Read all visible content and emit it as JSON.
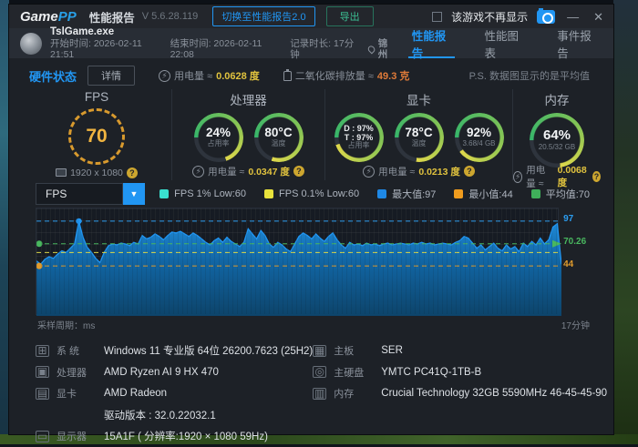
{
  "titlebar": {
    "logo_game": "Game",
    "logo_pp": "PP",
    "app_title": "性能报告",
    "version": "V 5.6.28.119",
    "switch_button": "切换至性能报告2.0",
    "export_button": "导出",
    "dont_show_label": "该游戏不再显示"
  },
  "gamebar": {
    "exe_name": "TslGame.exe",
    "start_time": "开始时间: 2026-02-11 21:51",
    "end_time": "结束时间: 2026-02-11 22:08",
    "duration": "记录时长: 17分钟",
    "location": "锦州",
    "tabs": [
      {
        "label": "性能报告",
        "active": true
      },
      {
        "label": "性能图表",
        "active": false
      },
      {
        "label": "事件报告",
        "active": false
      }
    ]
  },
  "statusbar": {
    "hardware_status": "硬件状态",
    "details_button": "详情",
    "power_label": "用电量 ≈",
    "power_value": "0.0628 度",
    "co2_label": "二氧化碳排放量 ≈",
    "co2_value": "49.3 克",
    "ps_note": "P.S. 数据图显示的是平均值"
  },
  "gauges": {
    "fps": {
      "title": "FPS",
      "value": "70",
      "resolution": "1920 x 1080"
    },
    "cpu": {
      "title": "处理器",
      "usage": "24%",
      "usage_label": "占用率",
      "temp": "80°C",
      "temp_label": "温度",
      "power_label": "用电量 ≈",
      "power_value": "0.0347 度"
    },
    "gpu": {
      "title": "显卡",
      "dt_line1": "D : 97%",
      "dt_line2": "T : 97%",
      "usage_label": "占用率",
      "temp": "78°C",
      "temp_label": "温度",
      "vram_pct": "92%",
      "vram_detail": "3.68/4 GB",
      "power_label": "用电量 ≈",
      "power_value": "0.0213 度"
    },
    "ram": {
      "title": "内存",
      "pct": "64%",
      "detail": "20.5/32 GB",
      "power_label": "用电量 ≈",
      "power_value": "0.0068 度"
    }
  },
  "chart_controls": {
    "selector_value": "FPS",
    "legend": [
      {
        "label": "FPS 1% Low:60",
        "color": "#39e0cf"
      },
      {
        "label": "FPS 0.1% Low:60",
        "color": "#e8e23c"
      },
      {
        "label": "最大值:97",
        "color": "#1e88e5"
      },
      {
        "label": "最小值:44",
        "color": "#f09c1e"
      },
      {
        "label": "平均值:70",
        "color": "#3faf5a"
      }
    ]
  },
  "chart_data": {
    "type": "area",
    "series_name": "FPS",
    "x_left_label": "采样周期：ms",
    "x_right_label": "17分钟",
    "ylim": [
      -15,
      112
    ],
    "stats": {
      "max": 97,
      "min": 44,
      "avg": 70.26,
      "fps_1pct_low": 60,
      "fps_01pct_low": 60
    },
    "ref_lines": [
      {
        "value": 97,
        "label": "97",
        "color": "#2b9df0",
        "name": "max"
      },
      {
        "value": 70.26,
        "label": "70.26",
        "color": "#49b75f",
        "name": "avg"
      },
      {
        "value": 60,
        "label": "",
        "color": "#ded94a",
        "name": "low"
      },
      {
        "value": 44,
        "label": "44",
        "color": "#e09b2d",
        "name": "min"
      }
    ],
    "line_color": "#2196f3",
    "values": [
      50,
      46,
      52,
      55,
      53,
      58,
      62,
      60,
      65,
      70,
      97,
      78,
      66,
      60,
      53,
      48,
      60,
      68,
      70,
      69,
      71,
      70,
      68,
      72,
      70,
      80,
      76,
      78,
      82,
      79,
      75,
      80,
      84,
      83,
      85,
      82,
      79,
      83,
      80,
      76,
      72,
      69,
      74,
      77,
      72,
      78,
      73,
      70,
      67,
      72,
      88,
      82,
      76,
      86,
      80,
      70,
      66,
      72,
      69,
      64,
      61,
      70,
      79,
      83,
      80,
      76,
      82,
      77,
      73,
      79,
      83,
      75,
      69,
      65,
      72,
      69,
      70,
      68,
      71,
      69,
      70,
      68,
      70,
      71,
      69,
      70,
      71,
      70,
      69,
      71,
      70,
      72,
      70,
      71,
      69,
      70,
      71,
      70,
      69,
      72,
      74,
      79,
      77,
      71,
      65,
      69,
      63,
      67,
      71,
      65,
      62,
      69,
      64,
      67,
      61,
      71,
      67,
      73,
      69,
      77,
      70,
      75,
      90,
      94,
      46
    ]
  },
  "sysinfo": {
    "rows_left": [
      {
        "label": "系 统",
        "value": "Windows 11 专业版 64位 26200.7623 (25H2)"
      },
      {
        "label": "处理器",
        "value": "AMD Ryzen AI 9 HX 470"
      },
      {
        "label": "显卡",
        "value": "AMD Radeon"
      },
      {
        "label": "",
        "value": "驱动版本 : 32.0.22032.1"
      },
      {
        "label": "显示器",
        "value": "15A1F ( 分辨率:1920 × 1080 59Hz)"
      }
    ],
    "rows_right": [
      {
        "label": "主板",
        "value": "SER"
      },
      {
        "label": "主硬盘",
        "value": "YMTC PC41Q-1TB-B"
      },
      {
        "label": "内存",
        "value": "Crucial Technology 32GB 5590MHz 46-45-45-90"
      }
    ]
  }
}
